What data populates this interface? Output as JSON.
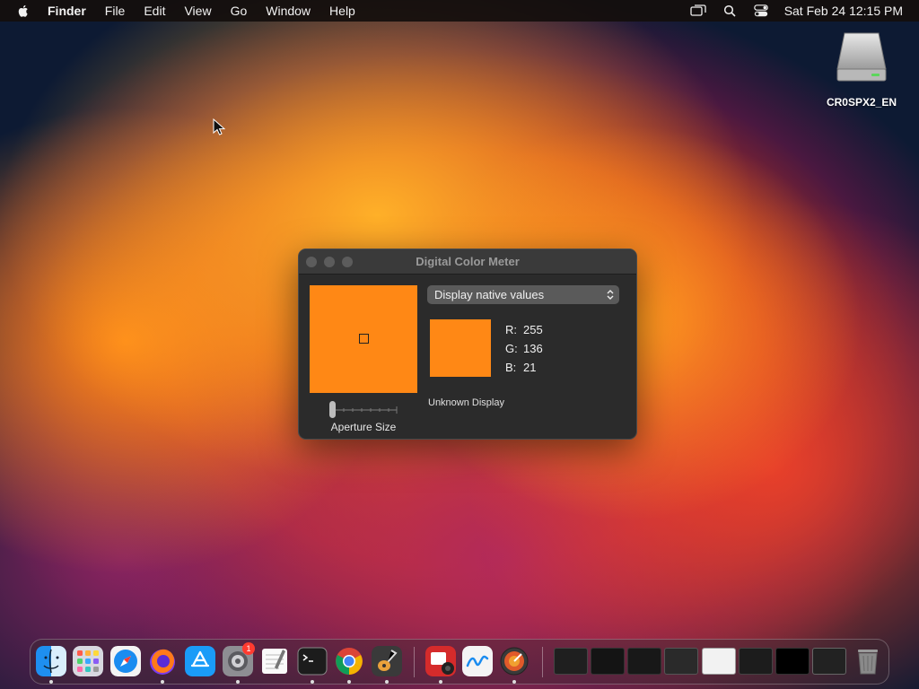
{
  "menubar": {
    "app": "Finder",
    "items": [
      "File",
      "Edit",
      "View",
      "Go",
      "Window",
      "Help"
    ],
    "clock": "Sat Feb 24  12:15 PM"
  },
  "desktop": {
    "drive_label": "CR0SPX2_EN"
  },
  "window": {
    "title": "Digital Color Meter",
    "popup_value": "Display native values",
    "r_label": "R:",
    "r_value": "255",
    "g_label": "G:",
    "g_value": "136",
    "b_label": "B:",
    "b_value": "21",
    "display_label": "Unknown Display",
    "aperture_label": "Aperture Size",
    "sampled_color": "#ff8815"
  },
  "dock": {
    "badge": "1",
    "apps": [
      "finder-icon",
      "launchpad-icon",
      "safari-icon",
      "firefox-icon",
      "app-store-icon",
      "system-settings-icon",
      "textedit-icon",
      "terminal-icon",
      "chrome-icon",
      "instruments-icon",
      "photo-booth-icon",
      "freeform-icon",
      "digital-color-meter-icon",
      "trash-icon"
    ]
  }
}
